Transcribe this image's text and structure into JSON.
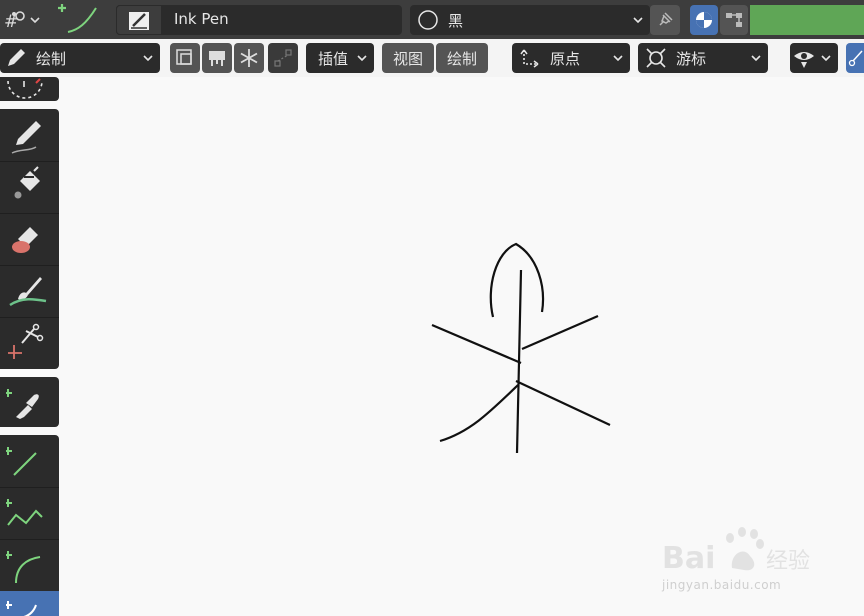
{
  "header": {
    "brush_name": "Ink Pen",
    "material_name": "黑",
    "material_name_full": "黑"
  },
  "toolbar": {
    "mode_label": "绘制",
    "interpolate_label": "插值",
    "view_label": "视图",
    "draw_label": "绘制",
    "origin_label": "原点",
    "cursor_label": "游标"
  },
  "sidebar": {
    "tools": [
      {
        "name": "draw-tool",
        "icon": "pencil-icon"
      },
      {
        "name": "fill-tool",
        "icon": "bucket-icon"
      },
      {
        "name": "erase-tool",
        "icon": "eraser-icon"
      },
      {
        "name": "tint-tool",
        "icon": "brush-icon"
      },
      {
        "name": "cutter-tool",
        "icon": "scissors-icon"
      },
      {
        "name": "eyedropper-tool",
        "icon": "eyedropper-icon"
      },
      {
        "name": "line-tool",
        "icon": "line-icon"
      },
      {
        "name": "polyline-tool",
        "icon": "polyline-icon"
      },
      {
        "name": "arc-tool",
        "icon": "arc-icon"
      },
      {
        "name": "curve-tool",
        "icon": "curve-icon"
      }
    ]
  },
  "colors": {
    "accent": "#4772b3",
    "green": "#5fa656",
    "canvas": "#f9f9f9",
    "panel": "#2b2b2b"
  },
  "watermark": {
    "site": "jingyan.baidu.com",
    "brand_cn": "经验"
  }
}
